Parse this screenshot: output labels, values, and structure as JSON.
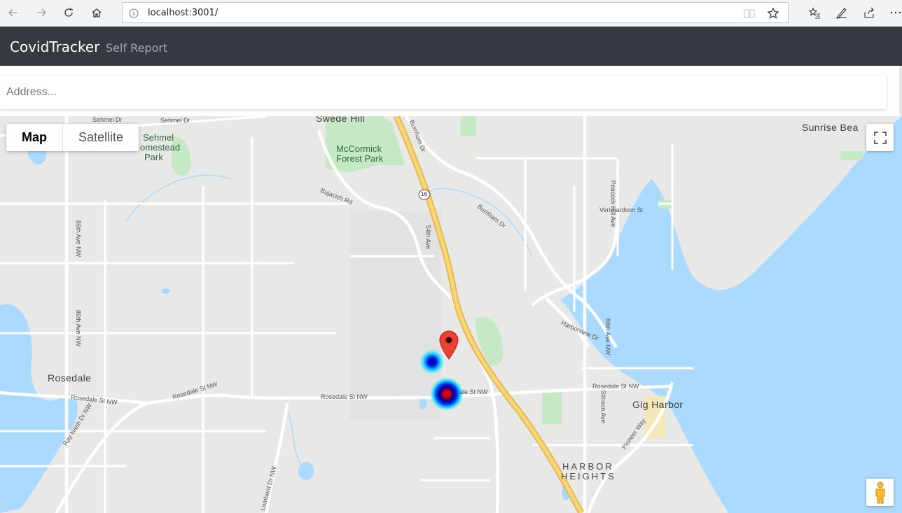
{
  "browser": {
    "url": "localhost:3001/"
  },
  "navbar": {
    "brand": "CovidTracker",
    "links": [
      "Self Report"
    ]
  },
  "search": {
    "placeholder": "Address..."
  },
  "map": {
    "type_options": [
      "Map",
      "Satellite"
    ],
    "selected_type": "Map",
    "labels": {
      "swede_hill": "Swede Hill",
      "sehmei_dr_1": "Sehmel Dr",
      "sehmei_dr_2": "Sehmel Dr",
      "sehmel_park_1": "Sehmel",
      "sehmel_park_2": "omestead",
      "sehmel_park_3": "Park",
      "mccormick_1": "McCormick",
      "mccormick_2": "Forest Park",
      "sunrise": "Sunrise Bea",
      "burnham_dr_top": "Burnham Dr",
      "burnham_dr": "Burnham Dr",
      "bujacich": "Bujacich Rd",
      "route16": "16",
      "ave_86_1": "86th Ave NW",
      "ave_86_2": "86th Ave NW",
      "ave_54": "54th Ave",
      "peacock": "Peacock Hill Ave",
      "vernhardson": "Vernhardson St",
      "harborview": "Harborview Dr",
      "rosedale": "Rosedale",
      "rosedale_st_1": "Rosedale St NW",
      "rosedale_st_2": "Rosedale St NW",
      "rosedale_st_3": "Rosedale St NW",
      "rosedale_st_4": "ale St NW",
      "rosedale_st_5": "Rosedale St NW",
      "ray_nash": "Ray Nash Dr NW",
      "gig_harbor": "Gig Harbor",
      "stinson": "Stinson Ave",
      "pioneer": "Pioneer Way",
      "harbor_heights_1": "HARBOR",
      "harbor_heights_2": "HEIGHTS",
      "lombard": "Lombard Dr NW",
      "ave_86_3": "86th Ave NW"
    },
    "heatmap_points": [
      {
        "intensity": "low"
      },
      {
        "intensity": "high"
      }
    ],
    "marker": {
      "color": "#ea4335"
    }
  },
  "colors": {
    "navbar": "#343a40",
    "water": "#aadaff",
    "park": "#c5e8c5",
    "highway": "#f8c967"
  }
}
